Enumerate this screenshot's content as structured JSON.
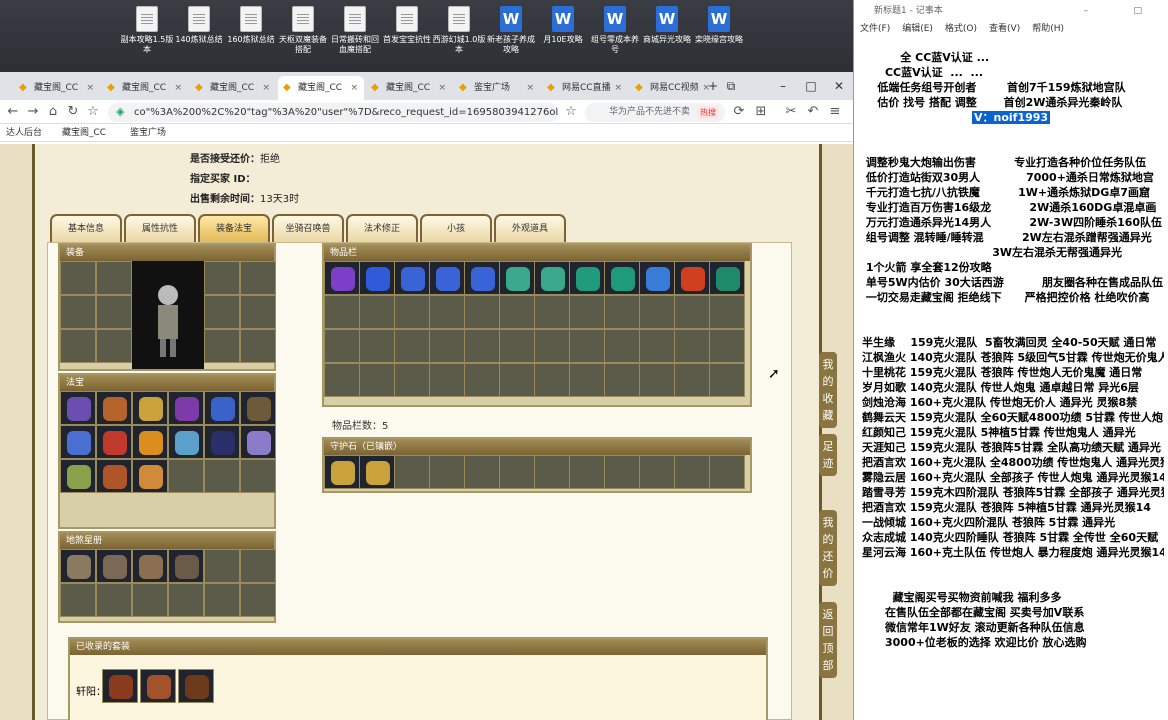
{
  "desktop_icons": [
    {
      "label": "副本攻略1.5版本",
      "type": "doc"
    },
    {
      "label": "140炼狱总结",
      "type": "doc"
    },
    {
      "label": "160炼狱总结",
      "type": "doc"
    },
    {
      "label": "天枢双魔装备搭配",
      "type": "doc"
    },
    {
      "label": "日常搬砖和回血魔搭配",
      "type": "doc"
    },
    {
      "label": "首发宝宝抗性",
      "type": "doc"
    },
    {
      "label": "西游幻城1.0版本",
      "type": "doc"
    },
    {
      "label": "新老孩子养成攻略",
      "type": "word"
    },
    {
      "label": "月10E攻略",
      "type": "word"
    },
    {
      "label": "组号零成本养号",
      "type": "word"
    },
    {
      "label": "商城异光攻略",
      "type": "word"
    },
    {
      "label": "栾晓缘宫攻略",
      "type": "word"
    }
  ],
  "browser": {
    "tabs": [
      "藏宝阁_CC",
      "藏宝阁_CC",
      "藏宝阁_CC",
      "藏宝阁_CC",
      "藏宝阁_CC",
      "鉴宝广场",
      "网易CC直播",
      "网易CC视频"
    ],
    "url": "co\"%3A%200%2C%20\"tag\"%3A%20\"user\"%7D&reco_request_id=1695803941276olE_o",
    "search_placeholder": "华为产品不先进不卖",
    "search_badge": "热搜",
    "bookmarks": [
      "达人后台",
      "藏宝阁_CC",
      "鉴宝广场"
    ]
  },
  "page": {
    "info": [
      {
        "label": "是否接受还价：",
        "value": "拒绝"
      },
      {
        "label": "指定买家 ID：",
        "value": ""
      },
      {
        "label": "出售剩余时间：",
        "value": "13天3时"
      }
    ],
    "tabs": [
      "基本信息",
      "属性抗性",
      "装备法宝",
      "坐骑召唤兽",
      "法术修正",
      "小孩",
      "外观道具"
    ],
    "active_tab": "装备法宝",
    "equip_title": "装备",
    "fabao_title": "法宝",
    "dizhen_title": "地煞星册",
    "items_title": "物品栏",
    "item_count_label": "物品栏数：",
    "item_count": "5",
    "guard_title": "守护石（已镶嵌）",
    "suits_title": "已收录的套装",
    "suit_label": "轩阳：",
    "side_buttons": [
      "我的收藏",
      "足迹",
      "我的还价",
      "返回顶部"
    ]
  },
  "notepad": {
    "title": "新标题1 - 记事本",
    "menu": [
      "文件(F)",
      "编辑(E)",
      "格式(O)",
      "查看(V)",
      "帮助(H)"
    ],
    "lines": [
      "          全 CC蓝V认证 ...",
      "      CC蓝V认证  ...  ...",
      "    低端任务组号开创者        首创7千159炼狱地宫队",
      "    估价 找号 搭配 调整       首创2W通杀异光秦岭队",
      "",
      "",
      " 调整秒鬼大炮输出伤害          专业打造各种价位任务队伍",
      " 低价打造站街双30男人            7000+通杀日常炼狱地宫",
      " 千元打造七抗/八抗铁魔          1W+通杀炼狱DG卓7画窟",
      " 专业打造百万伤害16级龙          2W通杀160DG卓混卓画",
      " 万元打造通杀异光14男人          2W-3W四阶睡杀160队伍",
      " 组号调整 混转睡/睡转混          2W左右混杀蹭帮强通异光",
      "                                  3W左右混杀无帮强通异光",
      " 1个火箭 享全套12份攻略",
      " 单号5W内估价 30大话西游          朋友圈各种在售成品队伍",
      " 一切交易走藏宝阁 拒绝线下      严格把控价格 杜绝吹价高",
      "",
      "",
      "半生缘    159克火混队  5畜牧满回灵 全40-50天赋 通日常",
      "江枫渔火 140克火混队 苍狼阵 5级回气5甘霖 传世炮无价鬼人",
      "十里桃花 159克火混队 苍狼阵 传世炮人无价鬼魔 通日常",
      "岁月如歌 140克火混队 传世人炮鬼 通卓越日常 异光6层",
      "剑烛沧海 160+克火混队 传世炮无价人 通异光 灵猴8禁",
      "鹤舞云天 159克火混队 全60天赋4800功绩 5甘霖 传世人炮",
      "红颜知己 159克火混队 5神植5甘霖 传世炮鬼人 通异光",
      "天涯知己 159克火混队 苍狼阵5甘霖 全队高功绩天赋 通异光",
      "把酒言欢 160+克火混队 全4800功绩 传世炮鬼人 通异光灵猴",
      "雾隐云居 160+克火混队 全部孩子 传世人炮鬼 通异光灵猴14",
      "踏雪寻芳 159克木四阶混队 苍狼阵5甘霖 全部孩子 通异光灵猴",
      "把酒言欢 159克火混队 苍狼阵 5神植5甘霖 通异光灵猴14",
      "一战倾城 160+克火四阶混队 苍狼阵 5甘霖 通异光",
      "众志成城 140克火四阶睡队 苍狼阵 5甘霖 全传世 全60天赋",
      "星河云海 160+克土队伍 传世炮人 暴力程度炮 通异光灵猴14",
      "",
      "",
      "        藏宝阁买号买物资前喊我 福利多多",
      "      在售队伍全部都在藏宝阁 买卖号加V联系",
      "      微信常年1W好友 滚动更新各种队伍信息",
      "      3000+位老板的选择 欢迎比价 放心选购"
    ],
    "highlight": "V：noif1993"
  }
}
